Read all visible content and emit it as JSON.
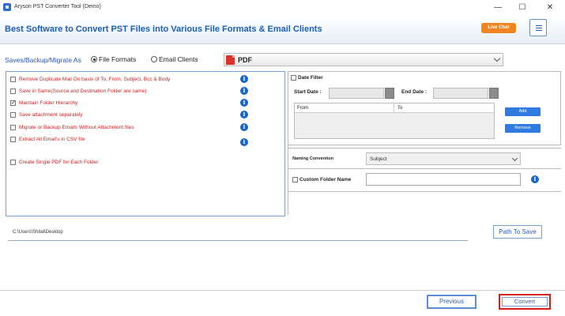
{
  "window": {
    "title": "Aryson PST Converter Tool (Demo)",
    "minimize_glyph": "—",
    "maximize_glyph": "☐",
    "close_glyph": "✕"
  },
  "header": {
    "title": "Best Software to Convert PST Files into Various File Formats & Email Clients",
    "live_chat_label": "Live Chat",
    "menu_icon": "hamburger-menu-icon"
  },
  "save_as": {
    "label": "Saves/Backup/Migrate As",
    "option_file_formats": "File Formats",
    "option_email_clients": "Email Clients",
    "selected_option": "File Formats",
    "format_value": "PDF",
    "format_icon": "pdf-file-icon"
  },
  "options": [
    {
      "label": "Remove Duplicate Mail On basis of To, From, Subject, Bcc & Body",
      "checked": false,
      "info": true
    },
    {
      "label": "Save in Same(Source and Destination Folder are same)",
      "checked": false,
      "info": true
    },
    {
      "label": "Maintain Folder Hierarchy",
      "checked": true,
      "info": true
    },
    {
      "label": "Save attachment separately",
      "checked": false,
      "info": true
    },
    {
      "label": "Migrate or Backup Emails Without Attachment files",
      "checked": false,
      "info": true
    },
    {
      "label": "Extract All Email's in CSV file",
      "checked": false,
      "info": true
    },
    {
      "label": "Create Single PDF for Each Folder",
      "checked": false,
      "info": false
    }
  ],
  "date_filter": {
    "label": "Date Filter",
    "checked": false,
    "start_label": "Start Date :",
    "end_label": "End Date :",
    "col_from": "From",
    "col_to": "To",
    "add_label": "Add",
    "remove_label": "Remove"
  },
  "naming": {
    "label": "Naming Convention",
    "value": "Subject"
  },
  "custom_folder": {
    "label": "Custom Folder Name",
    "checked": false,
    "value": ""
  },
  "path": {
    "value": "C:\\Users\\Shital\\Desktop",
    "button_label": "Path To Save"
  },
  "footer": {
    "previous_label": "Previous",
    "convert_label": "Convert"
  },
  "colors": {
    "accent_blue": "#1a5fb4",
    "option_red": "#d11f1f",
    "live_chat_orange": "#f0851f",
    "convert_border_red": "#d91c1c"
  }
}
